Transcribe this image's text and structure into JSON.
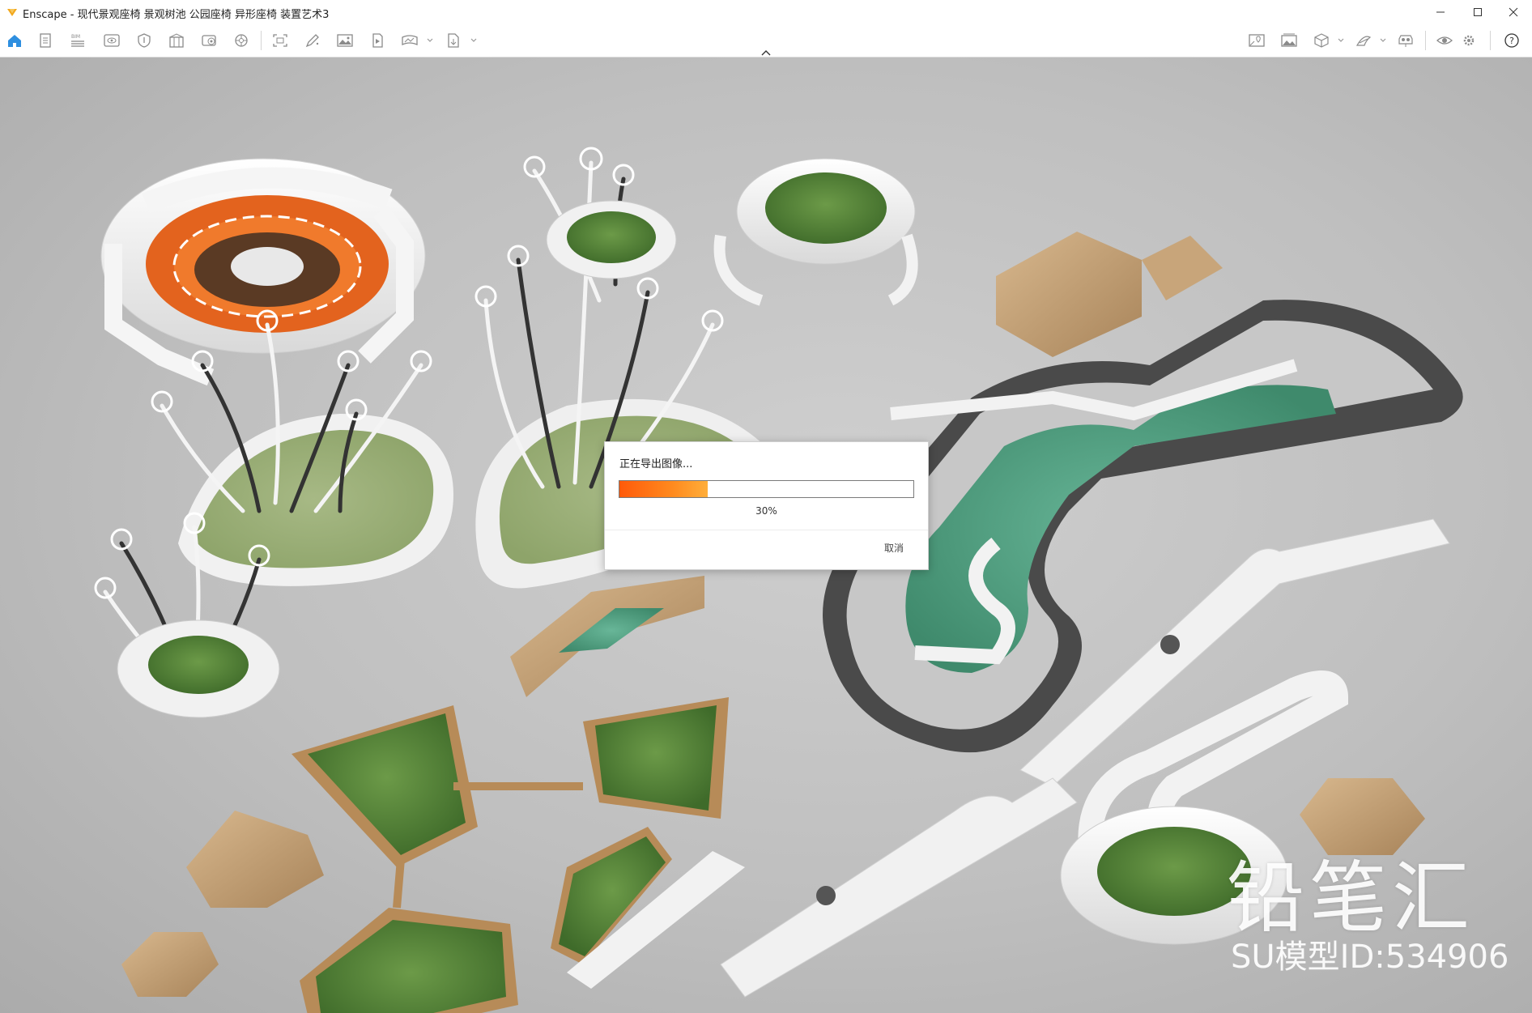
{
  "window": {
    "title": "Enscape - 现代景观座椅 景观树池 公园座椅 异形座椅 装置艺术3",
    "minimize_icon": "minimize-icon",
    "maximize_icon": "maximize-icon",
    "close_icon": "close-icon"
  },
  "toolbar": {
    "left_icons": [
      "home-icon",
      "document-icon",
      "bim-icon",
      "view-icon",
      "shield-icon",
      "library-icon",
      "settings-wheel-icon",
      "render-icon",
      "screenshot-icon",
      "pen-tool-icon",
      "image-icon",
      "video-icon",
      "panorama-icon",
      "export-icon"
    ],
    "bim_label": "BIM",
    "right_icons": [
      "map-pin-icon",
      "gallery-icon",
      "cube-icon",
      "sun-icon",
      "vr-icon",
      "eye-icon",
      "gear-icon",
      "help-icon"
    ],
    "help_label": "?"
  },
  "dialog": {
    "message": "正在导出图像...",
    "progress_percent": 30,
    "progress_label": "30%",
    "cancel_label": "取消"
  },
  "watermark": {
    "brand": "铅笔汇",
    "model_id": "SU模型ID:534906"
  },
  "colors": {
    "accent_orange": "#ff6a10",
    "grass": "#4f7f34",
    "wood": "#c09a6e",
    "white_structure": "#f2f2f2",
    "pool_water": "#4a9a7c",
    "ground": "#c0c0c0"
  }
}
